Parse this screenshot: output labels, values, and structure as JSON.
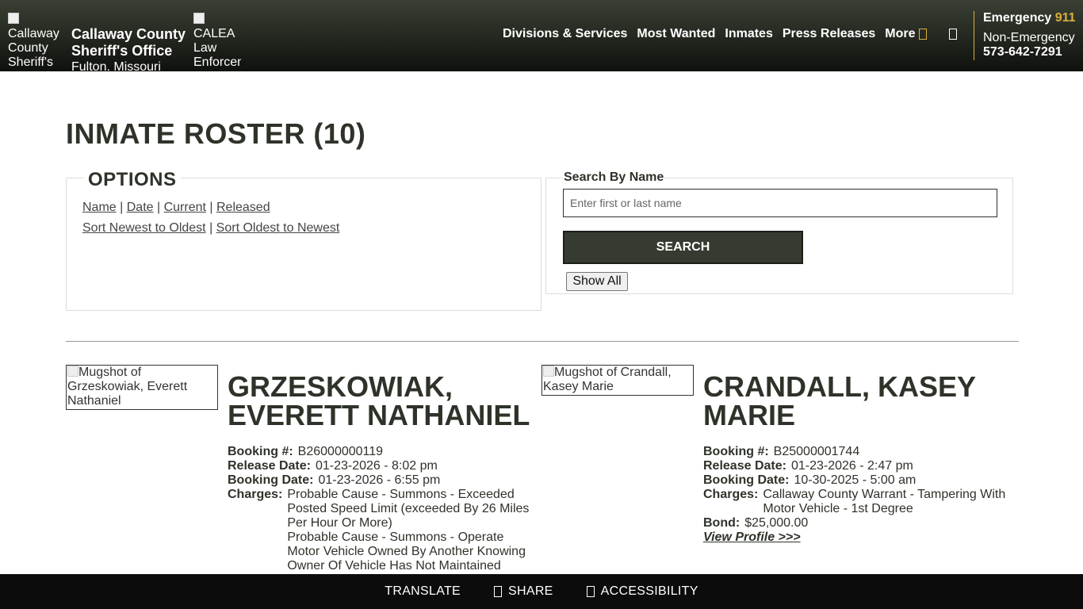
{
  "header": {
    "logo_alt": "Callaway County Sheriff's Office",
    "office_name": "Callaway County Sheriff's Office",
    "office_location": "Fulton, Missouri",
    "calea_alt": "CALEA Law Enforcement Accreditation",
    "nav": [
      "Divisions & Services",
      "Most Wanted",
      "Inmates",
      "Press Releases",
      "More"
    ],
    "emergency_label": "Emergency",
    "emergency_number": "911",
    "nonemergency_label": "Non-Emergency",
    "nonemergency_number": "573-642-7291",
    "accent_color": "#d9b13b"
  },
  "page": {
    "title": "INMATE ROSTER (10)"
  },
  "options": {
    "legend": "OPTIONS",
    "filter_links": [
      "Name",
      "Date",
      "Current",
      "Released"
    ],
    "sort_links": [
      "Sort Newest to Oldest",
      "Sort Oldest to Newest"
    ]
  },
  "search": {
    "label": "Search By Name",
    "placeholder": "Enter first or last name",
    "button_label": "SEARCH",
    "show_all_label": "Show All"
  },
  "inmates": [
    {
      "mugshot_alt": "Mugshot of Grzeskowiak, Everett Nathaniel",
      "name": "GRZESKOWIAK, EVERETT NATHANIEL",
      "booking_label": "Booking #:",
      "booking_number": "B26000000119",
      "release_label": "Release Date:",
      "release_date": "01-23-2026 - 8:02 pm",
      "booking_date_label": "Booking Date:",
      "booking_date": "01-23-2026 - 6:55 pm",
      "charges_label": "Charges:",
      "charges": [
        "Probable Cause - Summons - Exceeded Posted Speed Limit (exceeded By 26 Miles Per Hour Or More)",
        "Probable Cause - Summons - Operate Motor Vehicle Owned By Another Knowing Owner Of Vehicle Has Not Maintained"
      ]
    },
    {
      "mugshot_alt": "Mugshot of Crandall, Kasey Marie",
      "name": "CRANDALL, KASEY MARIE",
      "booking_label": "Booking #:",
      "booking_number": "B25000001744",
      "release_label": "Release Date:",
      "release_date": "01-23-2026 - 2:47 pm",
      "booking_date_label": "Booking Date:",
      "booking_date": "10-30-2025 - 5:00 am",
      "charges_label": "Charges:",
      "charges": [
        "Callaway County Warrant - Tampering With Motor Vehicle - 1st Degree"
      ],
      "bond_label": "Bond:",
      "bond": "$25,000.00",
      "view_profile_label": "View Profile >>>"
    }
  ],
  "footer": {
    "translate": "TRANSLATE",
    "share": "SHARE",
    "accessibility": "ACCESSIBILITY"
  }
}
